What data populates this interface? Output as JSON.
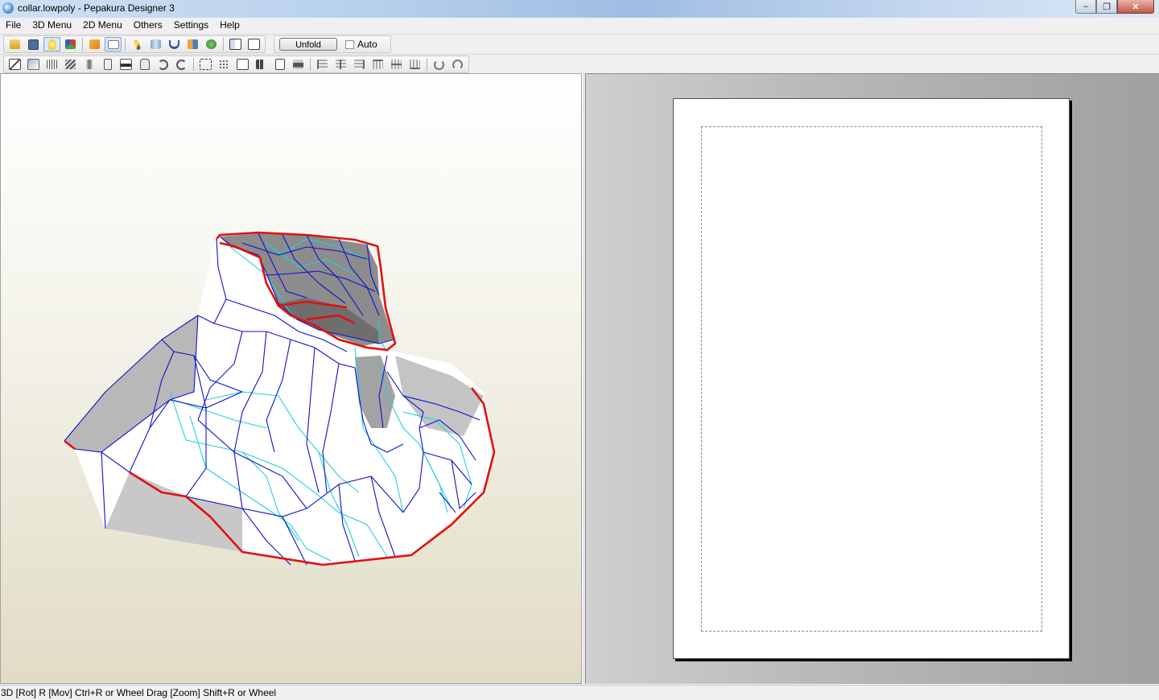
{
  "window": {
    "title": "collar.lowpoly - Pepakura Designer 3",
    "controls": [
      "minimize",
      "restore",
      "close"
    ]
  },
  "menubar": {
    "items": [
      {
        "label": "File"
      },
      {
        "label": "3D Menu"
      },
      {
        "label": "2D Menu"
      },
      {
        "label": "Others"
      },
      {
        "label": "Settings"
      },
      {
        "label": "Help"
      }
    ]
  },
  "toolbar1": {
    "unfold_label": "Unfold",
    "auto_label": "Auto",
    "auto_checked": false
  },
  "statusbar": {
    "text": "3D [Rot] R [Mov] Ctrl+R or Wheel Drag [Zoom] Shift+R or Wheel"
  },
  "colors": {
    "cut_edge": "#e01010",
    "mountain_fold": "#1010d0",
    "valley_fold": "#20d0e0"
  }
}
